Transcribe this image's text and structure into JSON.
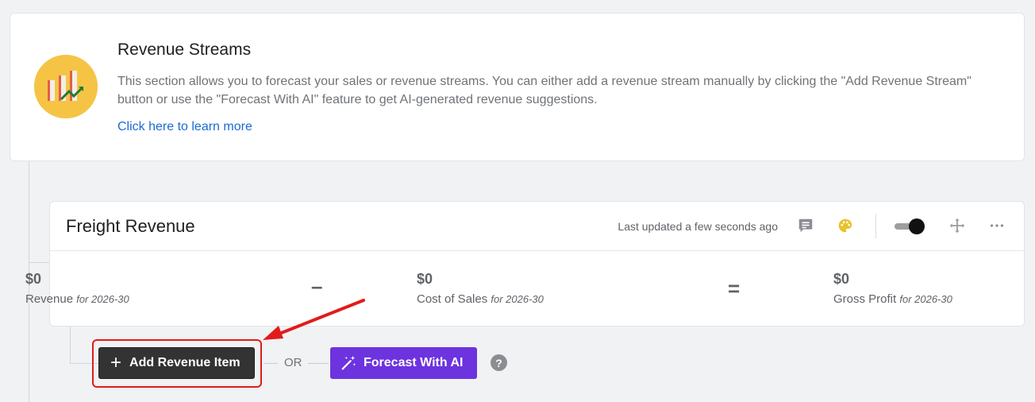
{
  "header": {
    "title": "Revenue Streams",
    "description": "This section allows you to forecast your sales or revenue streams. You can either add a revenue stream manually by clicking the \"Add Revenue Stream\" button or use the \"Forecast With AI\" feature to get AI-generated revenue suggestions.",
    "learn_more": "Click here to learn more",
    "logo_icon": "revenue-chart-icon"
  },
  "stream": {
    "title": "Freight Revenue",
    "last_updated": "Last updated a few seconds ago",
    "icons": [
      "comment-icon",
      "palette-icon",
      "toggle-switch",
      "move-icon",
      "more-icon"
    ],
    "toggle_on": true,
    "metrics": [
      {
        "value": "$0",
        "label": "Revenue",
        "period": "for 2026-30"
      },
      {
        "value": "$0",
        "label": "Cost of Sales",
        "period": "for 2026-30"
      },
      {
        "value": "$0",
        "label": "Gross Profit",
        "period": "for 2026-30"
      }
    ],
    "op_minus": "–",
    "op_equals": "="
  },
  "actions": {
    "add_label": "Add Revenue Item",
    "or_label": "OR",
    "ai_label": "Forecast With AI",
    "help_label": "?"
  },
  "colors": {
    "accent_purple": "#6d33df",
    "link_blue": "#1b6bd1",
    "highlight_red": "#e11b1b",
    "logo_yellow": "#f6c445",
    "palette_yellow": "#e8c22a"
  }
}
